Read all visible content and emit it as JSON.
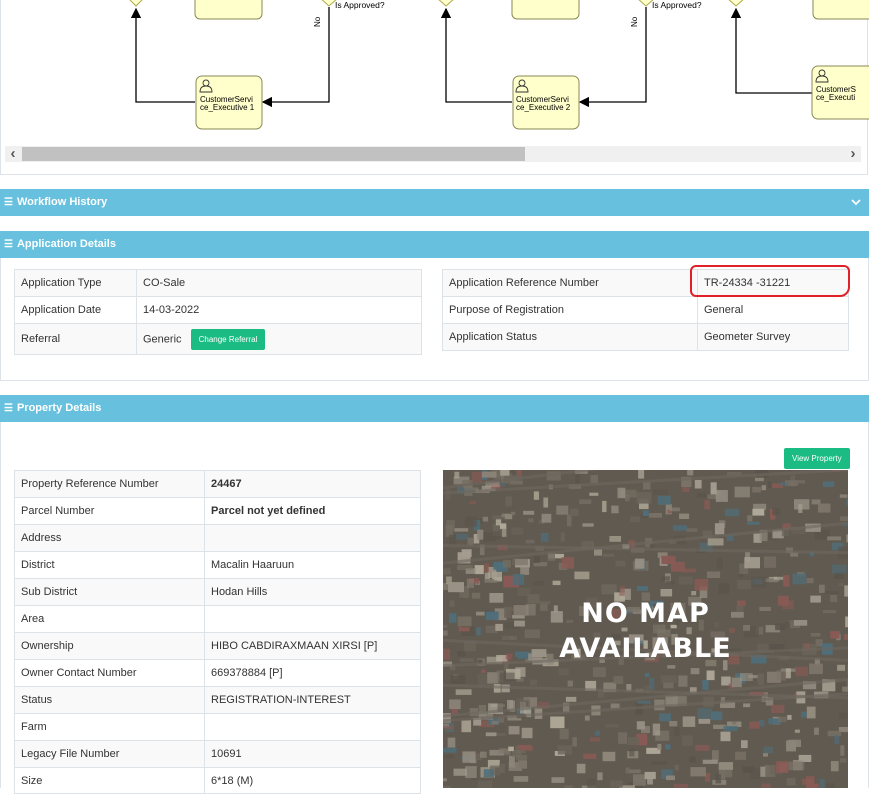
{
  "workflow": {
    "tasks": [
      {
        "label": "CustomerService_Executive 1",
        "line1": "CustomerServi",
        "line2": "ce_Executive 1"
      },
      {
        "label": "CustomerService_Executive 2",
        "line1": "CustomerServi",
        "line2": "ce_Executive 2"
      },
      {
        "label": "CustomerService_Executive",
        "line1": "CustomerS",
        "line2": "ce_Executi"
      }
    ],
    "gateway_label": "Is Approved?",
    "no_label": "No"
  },
  "workflow_history": {
    "title": "Workflow History"
  },
  "application_details": {
    "title": "Application Details",
    "left": [
      {
        "label": "Application Type",
        "value": "CO-Sale"
      },
      {
        "label": "Application Date",
        "value": "14-03-2022"
      },
      {
        "label": "Referral",
        "value": "Generic"
      }
    ],
    "change_referral_label": "Change Referral",
    "right": [
      {
        "label": "Application Reference Number",
        "value": "TR-24334 -31221"
      },
      {
        "label": "Purpose of Registration",
        "value": "General"
      },
      {
        "label": "Application Status",
        "value": "Geometer Survey"
      }
    ]
  },
  "property_details": {
    "title": "Property Details",
    "view_property_label": "View Property",
    "rows": [
      {
        "label": "Property Reference Number",
        "value": "24467"
      },
      {
        "label": "Parcel Number",
        "value": "Parcel not yet defined"
      },
      {
        "label": "Address",
        "value": ""
      },
      {
        "label": "District",
        "value": "Macalin Haaruun"
      },
      {
        "label": "Sub District",
        "value": "Hodan Hills"
      },
      {
        "label": "Area",
        "value": ""
      },
      {
        "label": "Ownership",
        "value": "HIBO CABDIRAXMAAN XIRSI [P]"
      },
      {
        "label": "Owner Contact Number",
        "value": "669378884 [P]"
      },
      {
        "label": "Status",
        "value": "REGISTRATION-INTEREST"
      },
      {
        "label": "Farm",
        "value": ""
      },
      {
        "label": "Legacy File Number",
        "value": "10691"
      },
      {
        "label": "Size",
        "value": "6*18 (M)"
      }
    ],
    "map_line1": "NO MAP",
    "map_line2": "AVAILABLE"
  },
  "colors": {
    "panel_header": "#67c1de",
    "button": "#1abc84",
    "highlight": "#e1212a",
    "task_fill": "#ffffcc"
  }
}
